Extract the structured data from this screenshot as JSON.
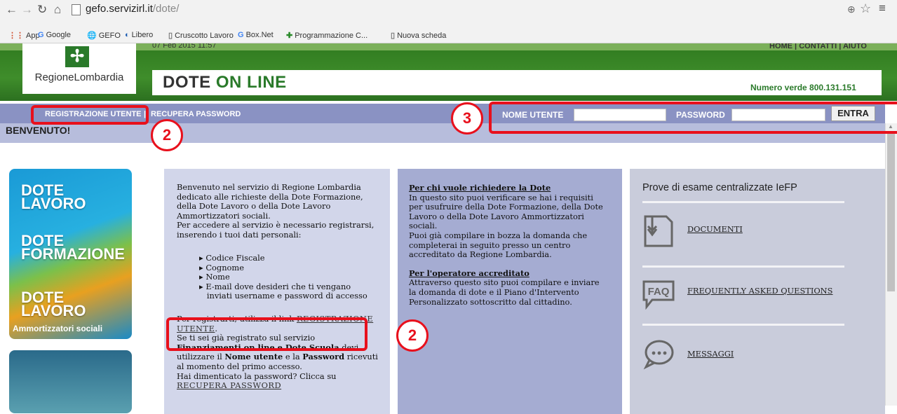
{
  "browser": {
    "url_host": "gefo.servizirl.it",
    "url_path": "/dote/",
    "bookmarks": [
      "App",
      "Google",
      "GEFO",
      "Libero",
      "Cruscotto Lavoro",
      "Box.Net",
      "Programmazione C...",
      "Nuova scheda"
    ]
  },
  "header": {
    "logo_text": "RegioneLombardia",
    "title_part1": "DOTE",
    "title_part2": "ON LINE",
    "phone": "Numero verde 800.131.151",
    "top_links": "HOME | CONTATTI | AIUTO",
    "date_cut": "07 Feb 2015 11:57"
  },
  "nav": {
    "register": "REGISTRAZIONE UTENTE",
    "sep": "|",
    "recover": "RECUPERA PASSWORD",
    "username_label": "NOME UTENTE",
    "password_label": "PASSWORD",
    "login_button": "ENTRA",
    "welcome": "BENVENUTO!"
  },
  "sidebar": {
    "dote1_a": "DOTE",
    "dote1_b": "LAVORO",
    "dote2_a": "DOTE",
    "dote2_b": "FORMAZIONE",
    "dote3_a": "DOTE",
    "dote3_b": "LAVORO",
    "amm": "Ammortizzatori sociali"
  },
  "col1": {
    "intro": [
      "Benvenuto nel servizio di Regione Lombardia",
      "dedicato alle richieste della Dote Formazione,",
      "della Dote Lavoro o della Dote Lavoro",
      "Ammortizzatori sociali.",
      "Per accedere al servizio è necessario registrarsi,",
      "inserendo i tuoi dati personali:"
    ],
    "list": [
      "Codice Fiscale",
      "Cognome",
      "Nome",
      "E-mail dove desideri che ti vengano",
      "inviati username e password di accesso"
    ],
    "reg_prefix": "Per registrarti, utilizza il link ",
    "reg_link1": "REGISTRAZIONE",
    "reg_link2": "UTENTE",
    "reg_suffix": ".",
    "p2_line1": "Se ti sei già registrato sul servizio",
    "p2_bold": "Finanziamenti on line e Dote Scuola",
    "p2_after": " devi",
    "p2_line3a": "utilizzare il ",
    "p2_nome": "Nome utente",
    "p2_e": " e la ",
    "p2_pass": "Password",
    "p2_ric": " ricevuti",
    "p2_line4": "al momento del primo accesso.",
    "p2_line5": "Hai dimenticato la password? Clicca su",
    "p2_link": "RECUPERA PASSWORD"
  },
  "col2": {
    "h1": "Per chi vuole richiedere la Dote",
    "p1": [
      "In questo sito puoi verificare se hai i requisiti",
      "per usufruire della Dote Formazione, della Dote",
      "Lavoro o della Dote Lavoro Ammortizzatori",
      "sociali.",
      "Puoi già compilare in bozza la domanda che",
      "completerai in seguito presso un centro",
      "accreditato da Regione Lombardia."
    ],
    "h2": "Per l'operatore accreditato",
    "p2": [
      "Attraverso questo sito puoi compilare e inviare",
      "la domanda di dote e il Piano d'Intervento",
      "Personalizzato sottoscritto dal cittadino."
    ]
  },
  "col3": {
    "title": "Prove di esame centralizzate IeFP",
    "links": [
      "DOCUMENTI",
      "FREQUENTLY ASKED QUESTIONS",
      "MESSAGGI"
    ],
    "faq_icon_text": "FAQ"
  },
  "annotations": {
    "n2a": "2",
    "n2b": "2",
    "n3": "3"
  },
  "colors": {
    "annotation_red": "#e8101c",
    "nav_blue": "#8a92c3",
    "brand_green": "#2a7a2a"
  }
}
